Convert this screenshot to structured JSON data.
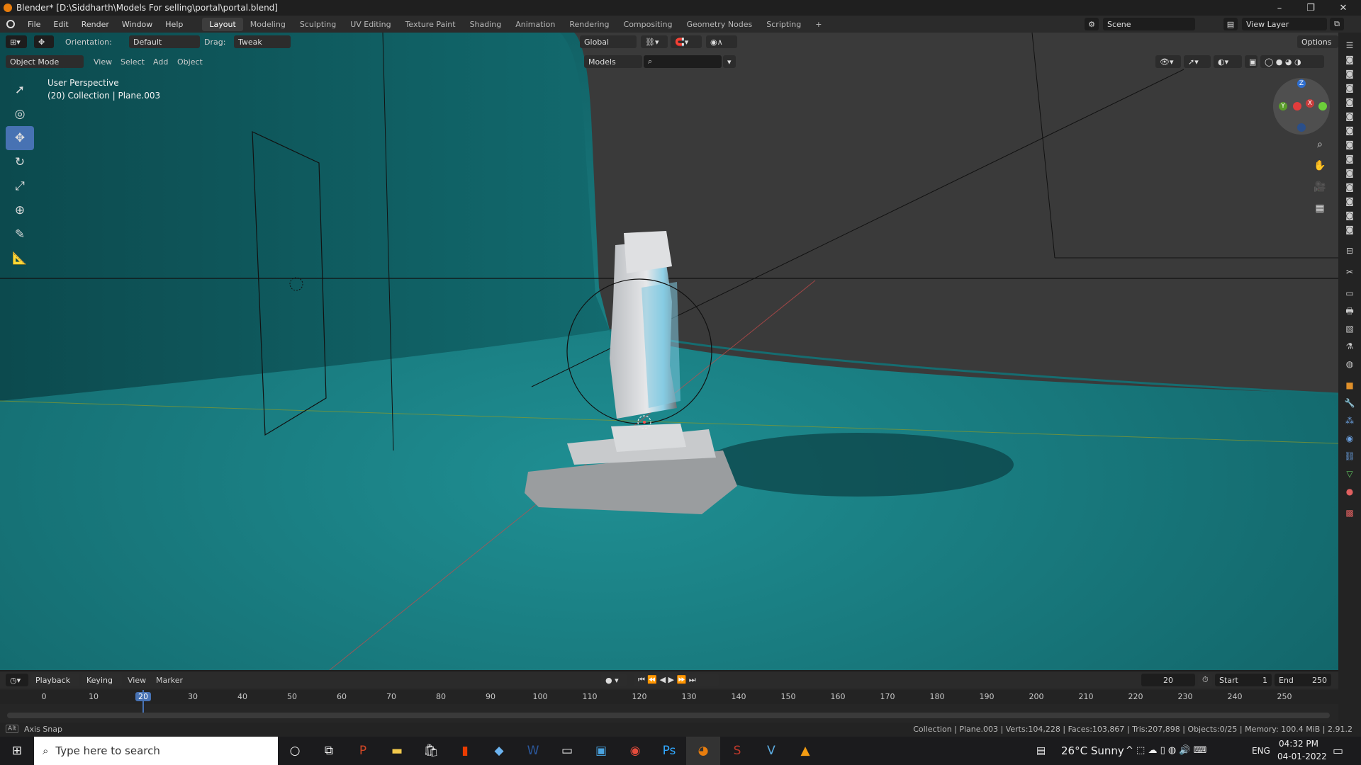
{
  "window": {
    "title": "Blender* [D:\\Siddharth\\Models For selling\\portal\\portal.blend]"
  },
  "menus": [
    "File",
    "Edit",
    "Render",
    "Window",
    "Help"
  ],
  "workspaces": [
    "Layout",
    "Modeling",
    "Sculpting",
    "UV Editing",
    "Texture Paint",
    "Shading",
    "Animation",
    "Rendering",
    "Compositing",
    "Geometry Nodes",
    "Scripting"
  ],
  "scene": {
    "name": "Scene",
    "view_layer": "View Layer"
  },
  "header": {
    "orientation_label": "Orientation:",
    "orientation_value": "Default",
    "drag_label": "Drag:",
    "drag_value": "Tweak",
    "transform_orientation": "Global",
    "options": "Options",
    "mode": "Object Mode",
    "view": "View",
    "select": "Select",
    "add": "Add",
    "object": "Object",
    "models": "Models"
  },
  "viewport": {
    "perspective": "User Perspective",
    "collection_info": "(20) Collection | Plane.003",
    "gizmo_axes": {
      "x": "X",
      "y": "Y",
      "z": "Z"
    },
    "world_color": "#1f8a8e"
  },
  "timeline": {
    "menus": [
      "Playback",
      "Keying",
      "View",
      "Marker"
    ],
    "current_frame": "20",
    "start_label": "Start",
    "start": "1",
    "end_label": "End",
    "end": "250",
    "ticks": [
      "0",
      "10",
      "20",
      "30",
      "40",
      "50",
      "60",
      "70",
      "80",
      "90",
      "100",
      "110",
      "120",
      "130",
      "140",
      "150",
      "160",
      "170",
      "180",
      "190",
      "200",
      "210",
      "220",
      "230",
      "240",
      "250"
    ],
    "current_tick": "20"
  },
  "status": {
    "left": "Axis Snap",
    "right": "Collection | Plane.003 | Verts:104,228 | Faces:103,867 | Tris:207,898 | Objects:0/25 | Memory: 100.4 MiB | 2.91.2"
  },
  "taskbar": {
    "search_placeholder": "Type here to search",
    "weather": "26°C  Sunny",
    "lang": "ENG",
    "time": "04:32 PM",
    "date": "04-01-2022"
  },
  "colors": {
    "accent": "#4772b3",
    "blender_orange": "#e87d0d"
  }
}
